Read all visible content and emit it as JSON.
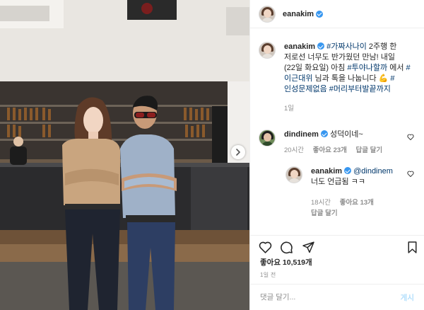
{
  "post": {
    "username": "eanakim",
    "caption_hashtag_1": "#가짜사나이",
    "caption_text_1": " 2주행 한 저로선 너무도 반가웠던 만남! 내일 (22일 화요일) 아침 ",
    "caption_hashtag_2": "#투야나할까",
    "caption_text_2": " 에서 ",
    "caption_hashtag_3": "#이근대위",
    "caption_text_3": " 님과 톡을 나눕니다 💪 ",
    "caption_hashtag_4": "#인성문제없음",
    "caption_text_4": " ",
    "caption_hashtag_5": "#머리부터발끝까지",
    "caption_time": "1일",
    "likes": "좋아요 10,519개",
    "date": "1일 전"
  },
  "comments": [
    {
      "username": "dindinem",
      "text": " 성덕이네~",
      "time": "20시간",
      "likes": "좋아요 23개",
      "reply_label": "답글 달기"
    },
    {
      "username": "eanakim",
      "mention": "@dindinem",
      "text": "너도 언급됨 ㅋㅋ",
      "time": "18시간",
      "likes": "좋아요 13개",
      "reply_label": "답글 달기"
    }
  ],
  "add_comment": {
    "placeholder": "댓글 달기...",
    "post_label": "게시"
  },
  "icons": {
    "like": "heart-icon",
    "comment": "comment-bubble-icon",
    "share": "paper-plane-icon",
    "save": "bookmark-icon",
    "next": "chevron-right-icon",
    "verified": "verified-badge-icon"
  },
  "colors": {
    "verified": "#3897f0",
    "hashtag": "#00376b",
    "muted": "#8e8e8e",
    "post_button": "#b2dffc"
  }
}
